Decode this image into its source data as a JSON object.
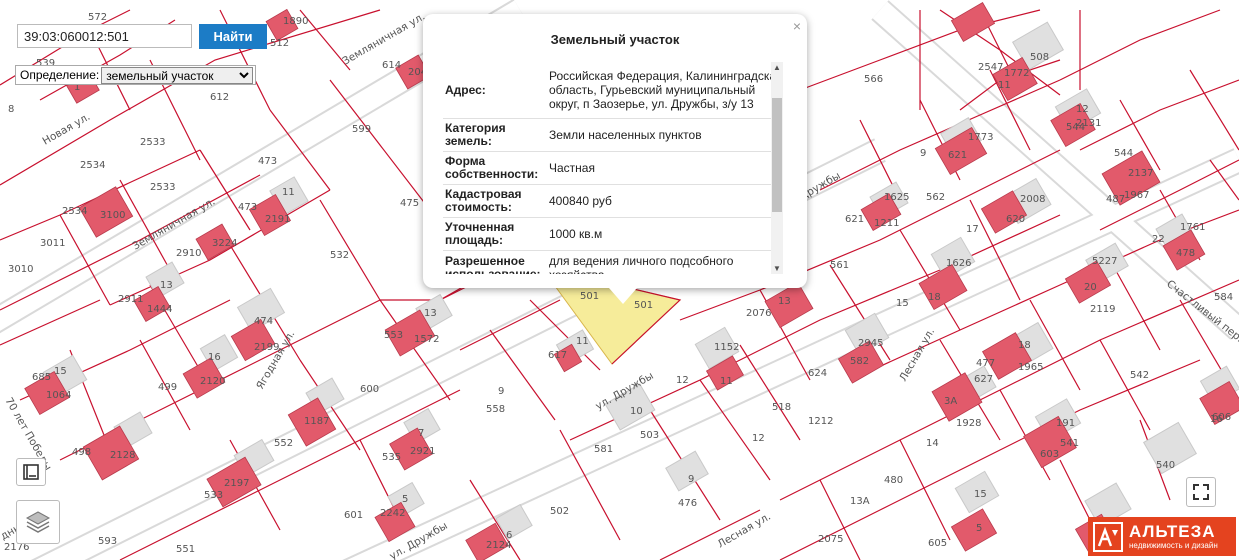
{
  "search": {
    "value": "39:03:060012:501",
    "button_label": "Найти"
  },
  "definition": {
    "label": "Определение:",
    "selected": "земельный участок"
  },
  "popup": {
    "title": "Земельный участок",
    "close_glyph": "×",
    "rows": [
      {
        "key": "Адрес:",
        "value": "Российская Федерация, Калининградская область, Гурьевский муниципальный округ, п Заозерье, ул. Дружбы, з/у 13"
      },
      {
        "key": "Категория земель:",
        "value": "Земли населенных пунктов"
      },
      {
        "key": "Форма собственности:",
        "value": "Частная"
      },
      {
        "key": "Кадастровая стоимость:",
        "value": "400840 руб"
      },
      {
        "key": "Уточненная площадь:",
        "value": "1000 кв.м"
      },
      {
        "key": "Разрешенное использование:",
        "value": "для ведения личного подсобного хозяйства"
      }
    ]
  },
  "map": {
    "parcel_labels": [
      "572",
      "1890",
      "512",
      "539",
      "612",
      "614",
      "2040",
      "1",
      "8",
      "2533",
      "599",
      "2534",
      "2533",
      "3100",
      "473",
      "11",
      "473",
      "2191",
      "475",
      "2534",
      "3011",
      "2910",
      "3224",
      "532",
      "3010",
      "13",
      "2911",
      "1444",
      "474",
      "2199",
      "13",
      "553",
      "1572",
      "16",
      "2120",
      "499",
      "685",
      "15",
      "1064",
      "600",
      "558",
      "9",
      "617",
      "11",
      "2128",
      "498",
      "552",
      "1187",
      "7",
      "535",
      "2921",
      "5",
      "2197",
      "533",
      "601",
      "2242",
      "551",
      "593",
      "2176",
      "502",
      "6",
      "2124",
      "581",
      "10",
      "503",
      "9",
      "476",
      "12",
      "1152",
      "11",
      "518",
      "12",
      "1212",
      "561",
      "2076",
      "13",
      "2945",
      "582",
      "624",
      "15",
      "1626",
      "18",
      "1625",
      "1211",
      "621",
      "9",
      "1773",
      "621",
      "562",
      "17",
      "2008",
      "620",
      "566",
      "2547",
      "11",
      "508",
      "1772",
      "12",
      "544",
      "2131",
      "544",
      "2137",
      "487",
      "1967",
      "22",
      "1761",
      "478",
      "5227",
      "20",
      "2119",
      "584",
      "18",
      "1965",
      "477",
      "627",
      "3A",
      "1928",
      "542",
      "191",
      "541",
      "16",
      "606",
      "603",
      "14",
      "540",
      "480",
      "13A",
      "2075",
      "605",
      "15",
      "5"
    ],
    "selected_labels": [
      "501",
      "501"
    ],
    "streets": [
      "Земляничная ул.",
      "Земляничная ул.",
      "Новая ул.",
      "Ягодная ул.",
      "70 лет Победы",
      "ул. Дружбы",
      "ул. Дружбы",
      "Лесная ул.",
      "Лесная ул.",
      "Счастливый пер.",
      "ул. Дружбы",
      "дный пер."
    ],
    "colors": {
      "parcel_line": "#c8102e",
      "building": "#e25a6b",
      "selected": "#f6ec9a",
      "house": "#e0e0e0"
    }
  },
  "controls": {
    "legend": "legend-icon",
    "layers": "layers-icon",
    "fullscreen": "fullscreen-icon"
  },
  "logo": {
    "name": "АЛЬТЕЗА",
    "tagline": "недвижимость и дизайн",
    "color": "#e4431f"
  }
}
